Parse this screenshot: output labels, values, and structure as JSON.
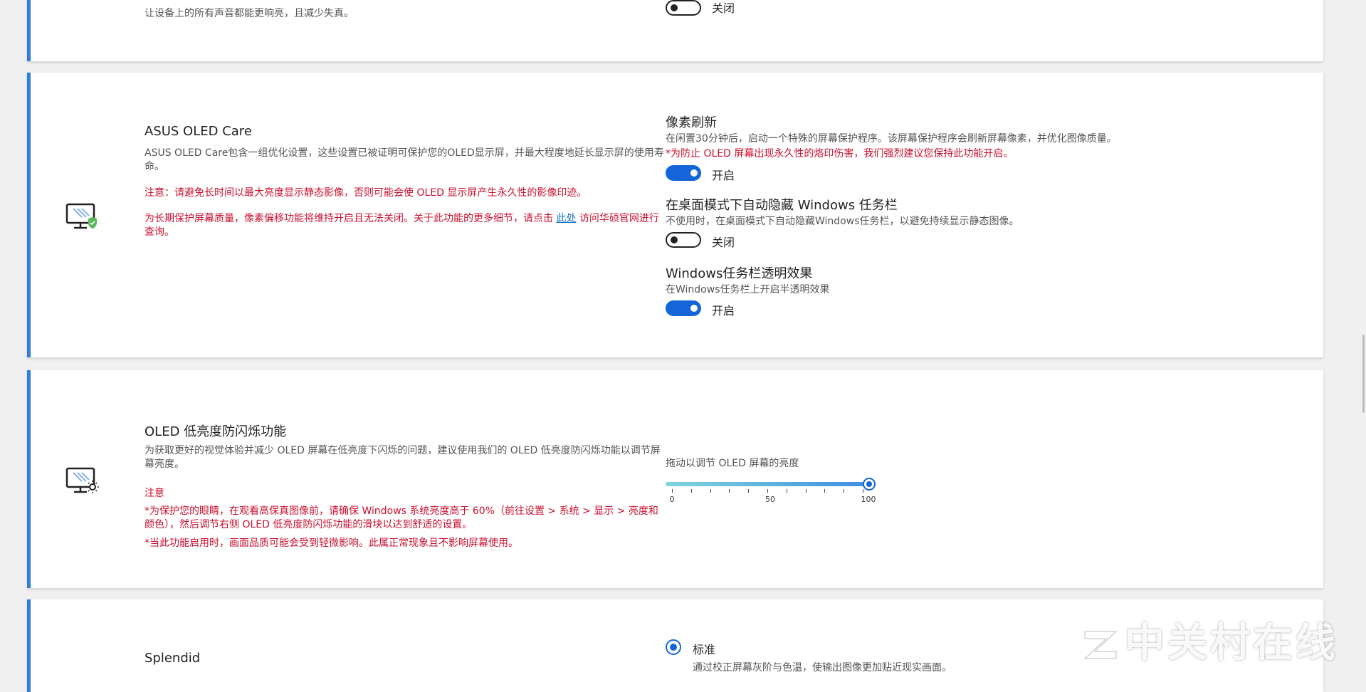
{
  "top_card": {
    "desc": "让设备上的所有声音都能更响亮，且减少失真。",
    "toggle_label": "关闭"
  },
  "oled_care": {
    "icon": "monitor-shield-icon",
    "title": "ASUS OLED Care",
    "desc": "ASUS OLED Care包含一组优化设置，这些设置已被证明可保护您的OLED显示屏，并最大程度地延长显示屏的使用寿命。",
    "warning": "注意：请避免长时间以最大亮度显示静态影像，否则可能会使 OLED 显示屏产生永久性的影像印迹。",
    "note_before": "为长期保护屏幕质量，像素偏移功能将维持开启且无法关闭。关于此功能的更多细节，请点击 ",
    "note_link": "此处",
    "note_after": " 访问华硕官网进行查询。",
    "options": [
      {
        "title": "像素刷新",
        "desc": "在闲置30分钟后，启动一个特殊的屏幕保护程序。该屏幕保护程序会刷新屏幕像素，并优化图像质量。",
        "warning": "*为防止 OLED 屏幕出现永久性的烙印伤害，我们强烈建议您保持此功能开启。",
        "state": "开启"
      },
      {
        "title": "在桌面模式下自动隐藏 Windows 任务栏",
        "desc": "不使用时，在桌面模式下自动隐藏Windows任务栏，以避免持续显示静态图像。",
        "state": "关闭"
      },
      {
        "title": "Windows任务栏透明效果",
        "desc": "在Windows任务栏上开启半透明效果",
        "state": "开启"
      }
    ]
  },
  "flicker": {
    "icon": "monitor-brightness-icon",
    "title": "OLED 低亮度防闪烁功能",
    "desc": "为获取更好的视觉体验并减少 OLED 屏幕在低亮度下闪烁的问题，建议使用我们的 OLED 低亮度防闪烁功能以调节屏幕亮度。",
    "note_title": "注意",
    "note1": "*为保护您的眼睛，在观看高保真图像前，请确保 Windows 系统亮度高于 60%（前往设置 > 系统 > 显示 > 亮度和颜色），然后调节右侧 OLED 低亮度防闪烁功能的滑块以达到舒适的设置。",
    "note2": "*当此功能启用时，画面品质可能会受到轻微影响。此属正常现象且不影响屏幕使用。",
    "slider_label": "拖动以调节 OLED 屏幕的亮度",
    "slider_value": 100,
    "slider_min": "0",
    "slider_mid": "50",
    "slider_max": "100"
  },
  "splendid": {
    "title": "Splendid",
    "option_label": "标准",
    "option_desc": "通过校正屏幕灰阶与色温，使输出图像更加贴近现实画面。"
  },
  "watermark": "中关村在线",
  "colors": {
    "accent": "#1565d8",
    "card_border": "#2f7fd6",
    "warning": "#c8102e"
  }
}
